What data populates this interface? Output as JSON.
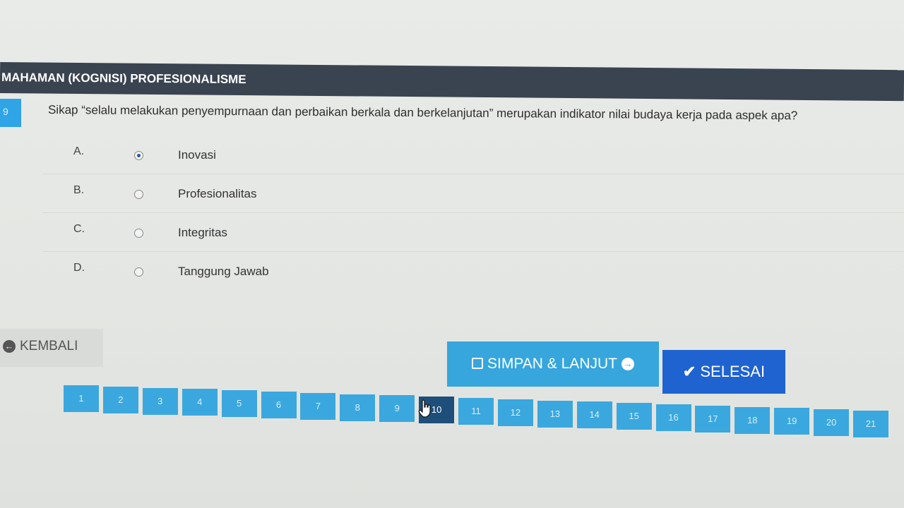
{
  "section": {
    "title": "MAHAMAN (KOGNISI) PROFESIONALISME"
  },
  "question": {
    "number": "9",
    "text": "Sikap “selalu melakukan penyempurnaan dan perbaikan berkala dan berkelanjutan” merupakan indikator nilai budaya kerja pada aspek apa?"
  },
  "options": [
    {
      "letter": "A.",
      "label": "Inovasi",
      "selected": true
    },
    {
      "letter": "B.",
      "label": "Profesionalitas",
      "selected": false
    },
    {
      "letter": "C.",
      "label": "Integritas",
      "selected": false
    },
    {
      "letter": "D.",
      "label": "Tanggung Jawab",
      "selected": false
    }
  ],
  "buttons": {
    "back_label": "KEMBALI",
    "save_next_label": "SIMPAN & LANJUT",
    "finish_label": "SELESAI"
  },
  "pagination": {
    "pages": [
      "1",
      "2",
      "3",
      "4",
      "5",
      "6",
      "7",
      "8",
      "9",
      "10",
      "11",
      "12",
      "13",
      "14",
      "15",
      "16",
      "17",
      "18",
      "19",
      "20",
      "21"
    ],
    "current": "10"
  },
  "colors": {
    "header_bg": "#3a4350",
    "accent_blue": "#36a6dd",
    "finish_blue": "#1f63d1",
    "active_page": "#1e4f7a"
  },
  "icons": [
    "back-circle-icon",
    "save-icon",
    "arrow-right-circle-icon",
    "check-icon",
    "hand-cursor-icon"
  ]
}
